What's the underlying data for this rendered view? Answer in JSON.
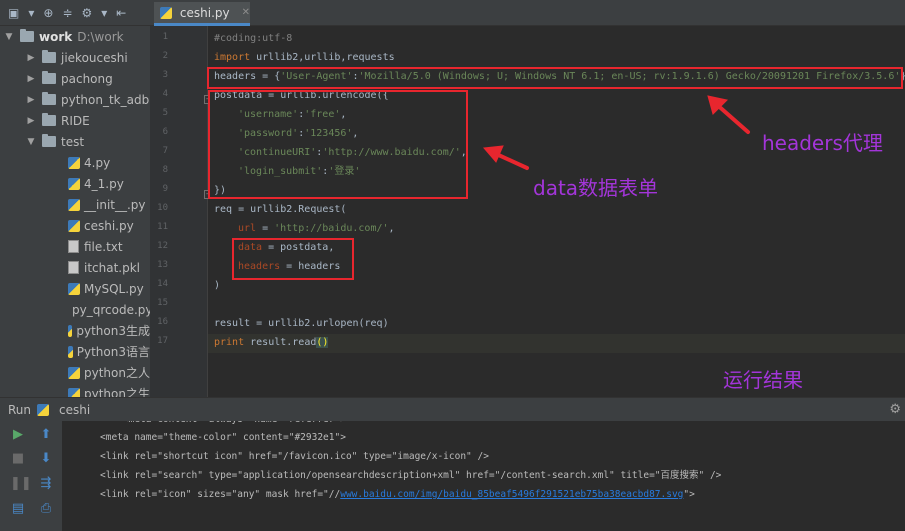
{
  "project": {
    "root": {
      "label": "work",
      "path": "D:\\work"
    },
    "items": [
      {
        "label": "jiekouceshi",
        "kind": "folder"
      },
      {
        "label": "pachong",
        "kind": "folder"
      },
      {
        "label": "python_tk_adb",
        "kind": "folder"
      },
      {
        "label": "RIDE",
        "kind": "folder"
      },
      {
        "label": "test",
        "kind": "folder-open"
      }
    ],
    "files": [
      {
        "label": "4.py",
        "kind": "py"
      },
      {
        "label": "4_1.py",
        "kind": "py"
      },
      {
        "label": "__init__.py",
        "kind": "py"
      },
      {
        "label": "ceshi.py",
        "kind": "py"
      },
      {
        "label": "file.txt",
        "kind": "txt"
      },
      {
        "label": "itchat.pkl",
        "kind": "txt"
      },
      {
        "label": "MySQL.py",
        "kind": "py"
      },
      {
        "label": "py_qrcode.py",
        "kind": "py"
      },
      {
        "label": "python3生成",
        "kind": "py"
      },
      {
        "label": "Python3语言",
        "kind": "py"
      },
      {
        "label": "python之人",
        "kind": "py"
      },
      {
        "label": "python之生",
        "kind": "py"
      }
    ]
  },
  "editor": {
    "tab_label": "ceshi.py",
    "line_numbers": [
      "1",
      "2",
      "3",
      "4",
      "5",
      "6",
      "7",
      "8",
      "9",
      "10",
      "11",
      "12",
      "13",
      "14",
      "15",
      "16",
      "17"
    ],
    "code": {
      "l1": "#coding:utf-8",
      "l2_kw": "import",
      "l2_rest": " urllib2,urllib,requests",
      "l3_a": "headers = {",
      "l3_key": "'User-Agent'",
      "l3_colon": ":",
      "l3_val": "'Mozilla/5.0 (Windows; U; Windows NT 6.1; en-US; rv:1.9.1.6) Gecko/20091201 Firefox/3.5.6'",
      "l3_end": "}",
      "l4": "postdata = urllib.urlencode({",
      "l5_k": "'username'",
      "l5_v": "'free'",
      "l6_k": "'password'",
      "l6_v": "'123456'",
      "l7_k": "'continueURI'",
      "l7_v": "'http://www.baidu.com/'",
      "l8_k": "'login_submit'",
      "l8_v": "'登录'",
      "l9": "})",
      "l10": "req = urllib2.Request(",
      "l11_p": "url",
      "l11_eq": " = ",
      "l11_v": "'http://baidu.com/'",
      "l12_p": "data",
      "l12_rest": " = postdata,",
      "l13_p": "headers",
      "l13_rest": " = headers",
      "l14": ")",
      "l16": "result = urllib2.urlopen(req)",
      "l17_kw": "print",
      "l17_rest": " result.read",
      "l17_paren": "()"
    }
  },
  "annotations": {
    "headers_note": "headers代理",
    "data_note": "data数据表单",
    "result_note": "运行结果"
  },
  "run": {
    "title": "Run",
    "config": "ceshi",
    "lines": {
      "c0": "    <meta content=\"always\" name=\"referrer\">",
      "c1": "<meta name=\"theme-color\" content=\"#2932e1\">",
      "c2": "<link rel=\"shortcut icon\" href=\"/favicon.ico\" type=\"image/x-icon\" />",
      "c3": "<link rel=\"search\" type=\"application/opensearchdescription+xml\" href=\"/content-search.xml\" title=\"百度搜索\" />",
      "c4_a": "<link rel=\"icon\" sizes=\"any\" mask href=\"//",
      "c4_link": "www.baidu.com/img/baidu_85beaf5496f291521eb75ba38eacbd87.svg",
      "c4_b": "\">"
    }
  },
  "colors": {
    "annotation_box": "#e8262e",
    "annotation_text": "#a335d9",
    "keyword": "#cc7832",
    "string": "#6a8759"
  }
}
